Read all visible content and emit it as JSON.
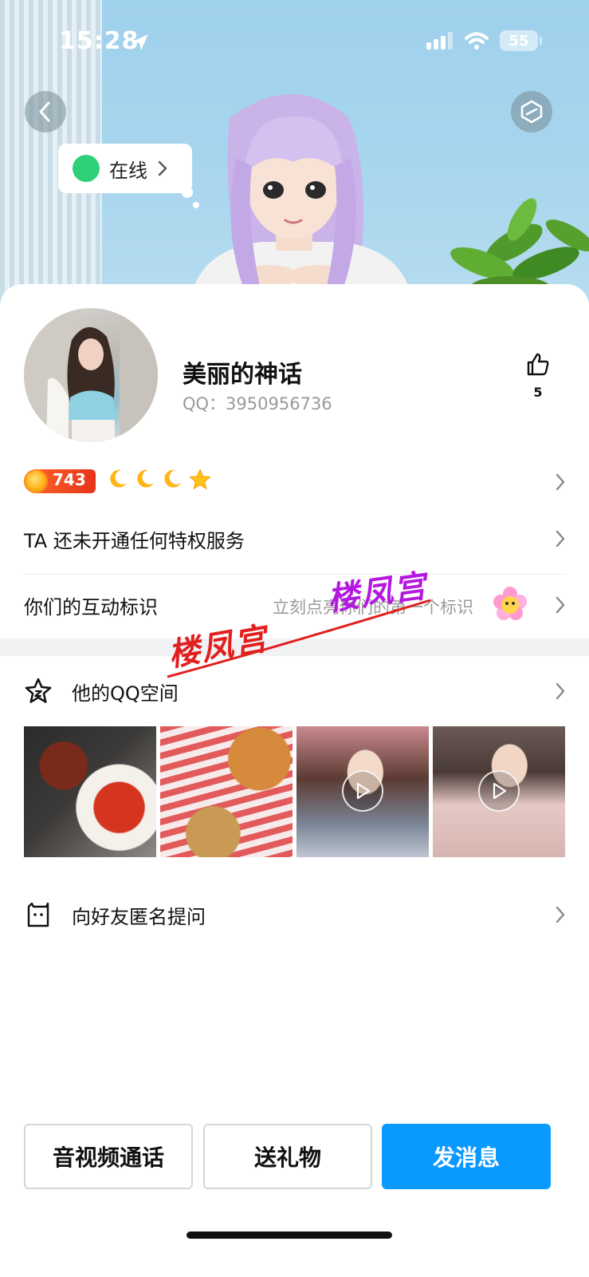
{
  "status_bar": {
    "time": "15:28",
    "battery": "55"
  },
  "hero": {
    "online_status": "在线"
  },
  "profile": {
    "nickname": "美丽的神话",
    "qq_label": "QQ：3950956736",
    "likes": "5",
    "level": "743"
  },
  "rows": {
    "privilege": "TA 还未开通任何特权服务",
    "interaction": "你们的互动标识",
    "interaction_hint": "立刻点亮你们的第一个标识",
    "qzone": "他的QQ空间",
    "anonymous_question": "向好友匿名提问"
  },
  "watermark": {
    "text": "楼凤宫"
  },
  "actions": {
    "call": "音视频通话",
    "gift": "送礼物",
    "message": "发消息"
  },
  "colors": {
    "primary": "#0a99ff",
    "online": "#2fd07a",
    "level_badge": "#e8331a"
  }
}
